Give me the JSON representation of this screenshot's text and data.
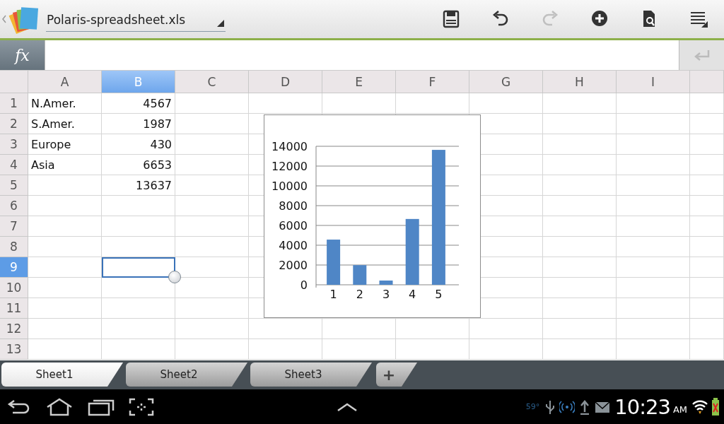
{
  "toolbar": {
    "title": "Polaris-spreadsheet.xls",
    "buttons": [
      {
        "kind": "save",
        "disabled": false
      },
      {
        "kind": "undo",
        "disabled": false
      },
      {
        "kind": "redo",
        "disabled": true
      },
      {
        "kind": "add",
        "disabled": false
      },
      {
        "kind": "tools",
        "disabled": false
      },
      {
        "kind": "menu",
        "disabled": false
      }
    ]
  },
  "formula_bar": {
    "label": "fx",
    "enter_disabled": true
  },
  "sheet": {
    "columns": [
      {
        "label": "A",
        "selected": false
      },
      {
        "label": "B",
        "selected": true
      },
      {
        "label": "C",
        "selected": false
      },
      {
        "label": "D",
        "selected": false
      },
      {
        "label": "E",
        "selected": false
      },
      {
        "label": "F",
        "selected": false
      },
      {
        "label": "G",
        "selected": false
      },
      {
        "label": "H",
        "selected": false
      },
      {
        "label": "I",
        "selected": false
      }
    ],
    "rows": [
      {
        "label": "1",
        "selected": false,
        "cells": [
          {
            "kind": "text",
            "text": "N.Amer.",
            "selected": false
          },
          {
            "kind": "number",
            "text": "4567",
            "selected": false
          }
        ]
      },
      {
        "label": "2",
        "selected": false,
        "cells": [
          {
            "kind": "text",
            "text": "S.Amer.",
            "selected": false
          },
          {
            "kind": "number",
            "text": "1987",
            "selected": false
          }
        ]
      },
      {
        "label": "3",
        "selected": false,
        "cells": [
          {
            "kind": "text",
            "text": "Europe",
            "selected": false
          },
          {
            "kind": "number",
            "text": "430",
            "selected": false
          }
        ]
      },
      {
        "label": "4",
        "selected": false,
        "cells": [
          {
            "kind": "text",
            "text": "Asia",
            "selected": false
          },
          {
            "kind": "number",
            "text": "6653",
            "selected": false
          }
        ]
      },
      {
        "label": "5",
        "selected": false,
        "cells": [
          {
            "kind": "blank",
            "selected": false
          },
          {
            "kind": "number",
            "text": "13637",
            "selected": false
          }
        ]
      },
      {
        "label": "6",
        "selected": false,
        "cells": []
      },
      {
        "label": "7",
        "selected": false,
        "cells": []
      },
      {
        "label": "8",
        "selected": false,
        "cells": []
      },
      {
        "label": "9",
        "selected": true,
        "cells": [
          {
            "kind": "blank",
            "selected": false
          },
          {
            "kind": "blank",
            "selected": true
          }
        ]
      },
      {
        "label": "10",
        "selected": false,
        "cells": []
      },
      {
        "label": "11",
        "selected": false,
        "cells": []
      },
      {
        "label": "12",
        "selected": false,
        "cells": []
      },
      {
        "label": "13",
        "selected": false,
        "cells": []
      }
    ],
    "chart_data": {
      "type": "bar",
      "grid": true,
      "categories": [
        "1",
        "2",
        "3",
        "4",
        "5"
      ],
      "ylim": [
        0,
        14000
      ],
      "yticks": [
        0,
        2000,
        4000,
        6000,
        8000,
        10000,
        12000,
        14000
      ],
      "series": [
        {
          "color": "#4f86c6",
          "values": [
            4567,
            1987,
            430,
            6653,
            13637
          ]
        }
      ]
    }
  },
  "sheet_tabs": [
    {
      "label": "Sheet1",
      "selected": true
    },
    {
      "label": "Sheet2",
      "selected": false
    },
    {
      "label": "Sheet3",
      "selected": false
    }
  ],
  "add_sheet": "+",
  "status_bar": {
    "temperature": "59°",
    "time": "10:23",
    "ampm": "AM"
  }
}
